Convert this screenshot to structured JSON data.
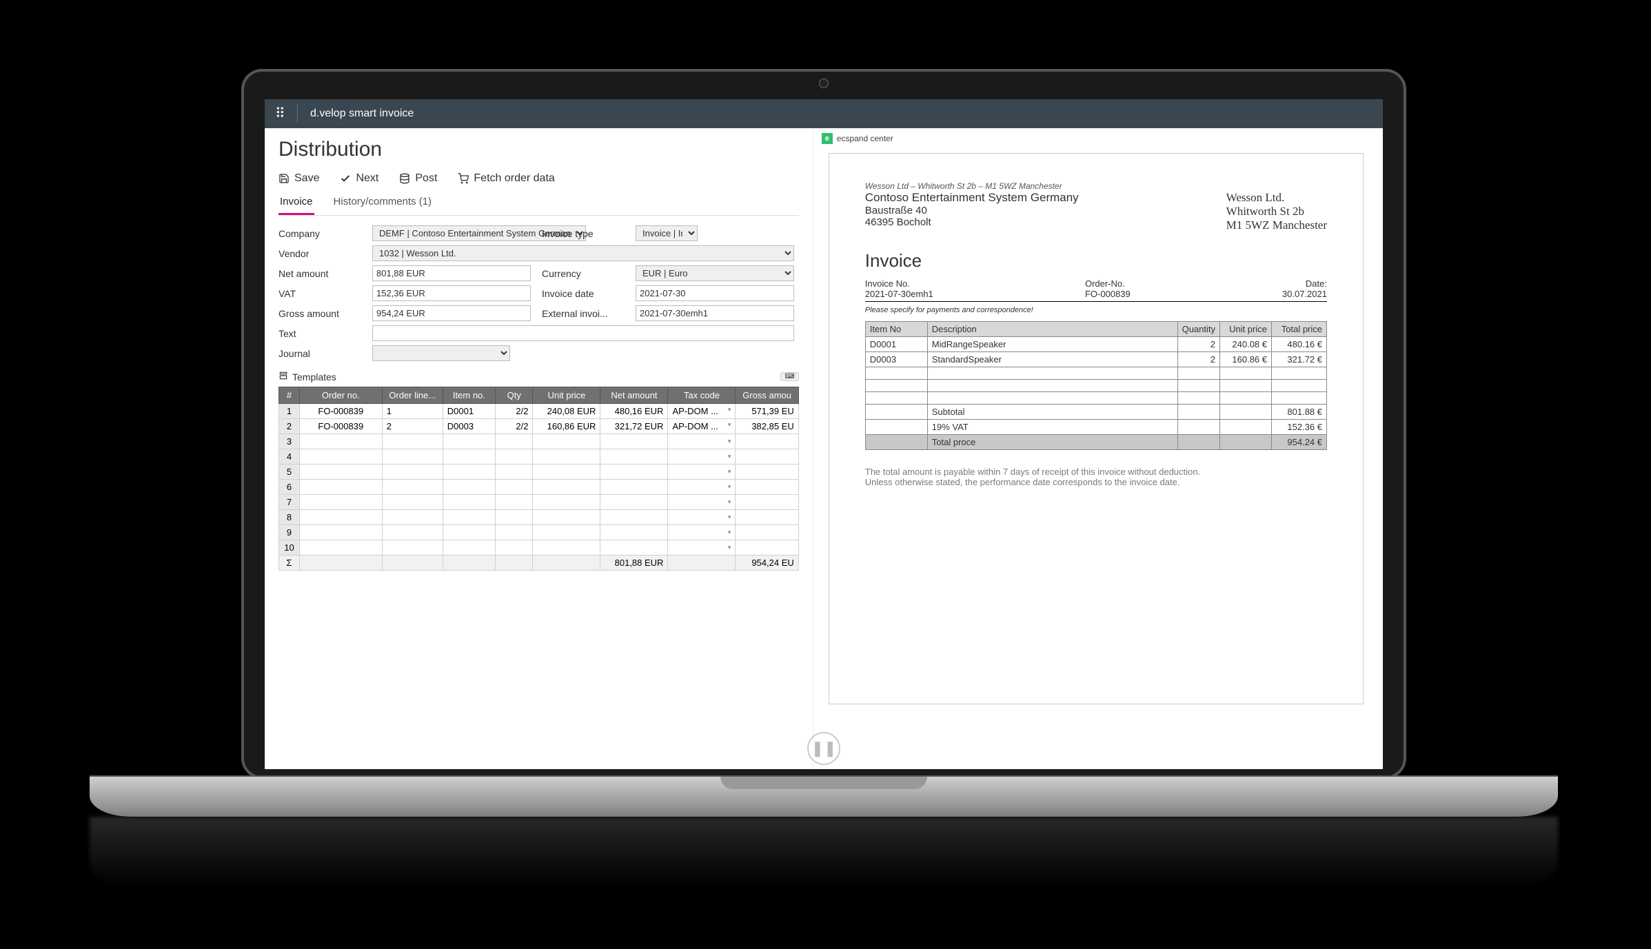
{
  "app": {
    "name": "d.velop smart invoice"
  },
  "page": {
    "title": "Distribution"
  },
  "toolbar": {
    "save": "Save",
    "next": "Next",
    "post": "Post",
    "fetch": "Fetch order data"
  },
  "tabs": {
    "invoice": "Invoice",
    "history": "History/comments (1)"
  },
  "form": {
    "company_label": "Company",
    "company_value": "DEMF | Contoso Entertainment System Germany",
    "invoice_type_label": "Invoice type",
    "invoice_type_value": "Invoice | Ir",
    "vendor_label": "Vendor",
    "vendor_value": "1032 | Wesson Ltd.",
    "net_label": "Net amount",
    "net_value": "801,88 EUR",
    "currency_label": "Currency",
    "currency_value": "EUR | Euro",
    "vat_label": "VAT",
    "vat_value": "152,36 EUR",
    "invdate_label": "Invoice date",
    "invdate_value": "2021-07-30",
    "gross_label": "Gross amount",
    "gross_value": "954,24 EUR",
    "ext_label": "External invoi...",
    "ext_value": "2021-07-30emh1",
    "text_label": "Text",
    "text_value": "",
    "journal_label": "Journal",
    "journal_value": ""
  },
  "templates_label": "Templates",
  "line_headers": {
    "n": "#",
    "order": "Order no.",
    "orderline": "Order line...",
    "item": "Item no.",
    "qty": "Qty",
    "unit": "Unit price",
    "net": "Net amount",
    "tax": "Tax code",
    "gross": "Gross amou"
  },
  "lines": [
    {
      "n": "1",
      "order": "FO-000839",
      "orderline": "1",
      "item": "D0001",
      "qty": "2/2",
      "unit": "240,08 EUR",
      "net": "480,16 EUR",
      "tax": "AP-DOM ...",
      "gross": "571,39 EU"
    },
    {
      "n": "2",
      "order": "FO-000839",
      "orderline": "2",
      "item": "D0003",
      "qty": "2/2",
      "unit": "160,86 EUR",
      "net": "321,72 EUR",
      "tax": "AP-DOM ...",
      "gross": "382,85 EU"
    }
  ],
  "empty_rows": [
    "3",
    "4",
    "5",
    "6",
    "7",
    "8",
    "9",
    "10"
  ],
  "sum": {
    "sym": "Σ",
    "net": "801,88 EUR",
    "gross": "954,24 EU"
  },
  "preview": {
    "app": "ecspand center",
    "sender_line": "Wesson Ltd – Whitworth St 2b – M1 5WZ Manchester",
    "recipient_name": "Contoso Entertainment System Germany",
    "recipient_street": "Baustraße 40",
    "recipient_city": "46395 Bocholt",
    "vendor_name": "Wesson Ltd.",
    "vendor_street": "Whitworth St 2b",
    "vendor_city": "M1 5WZ Manchester",
    "title": "Invoice",
    "invno_label": "Invoice No.",
    "invno": "2021-07-30emh1",
    "orderno_label": "Order-No.",
    "orderno": "FO-000839",
    "date_label": "Date:",
    "date": "30.07.2021",
    "note": "Please specify for payments and correspondence!",
    "th_item": "Item No",
    "th_desc": "Description",
    "th_qty": "Quantity",
    "th_unit": "Unit price",
    "th_total": "Total price",
    "items": [
      {
        "item": "D0001",
        "desc": "MidRangeSpeaker",
        "qty": "2",
        "unit": "240.08 €",
        "total": "480.16 €"
      },
      {
        "item": "D0003",
        "desc": "StandardSpeaker",
        "qty": "2",
        "unit": "160.86 €",
        "total": "321.72 €"
      }
    ],
    "subtotal_label": "Subtotal",
    "subtotal": "801.88 €",
    "vat_label": "19% VAT",
    "vat": "152.36 €",
    "total_label": "Total proce",
    "total": "954.24 €",
    "footer1": "The total amount is payable within 7 days of receipt of this invoice without deduction.",
    "footer2": "Unless otherwise stated, the performance date corresponds to the invoice date."
  }
}
